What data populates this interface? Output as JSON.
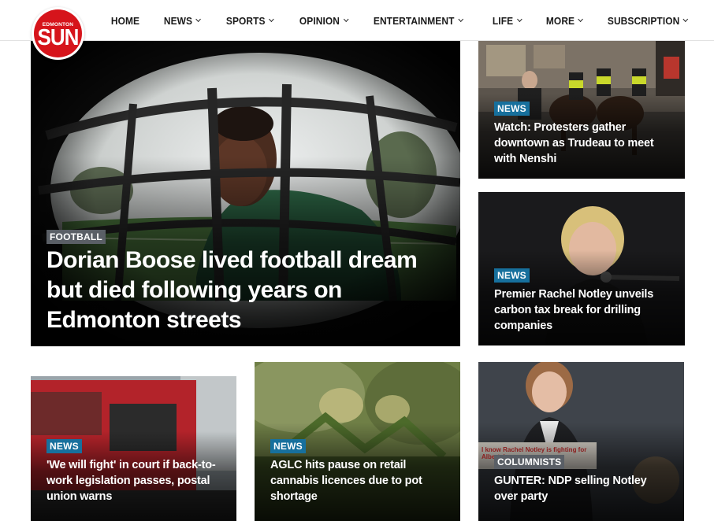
{
  "site": {
    "logo_top": "EDMONTON",
    "logo_main": "SUN"
  },
  "nav": {
    "items": [
      {
        "label": "HOME",
        "dropdown": false
      },
      {
        "label": "NEWS",
        "dropdown": true
      },
      {
        "label": "SPORTS",
        "dropdown": true
      },
      {
        "label": "OPINION",
        "dropdown": true
      },
      {
        "label": "ENTERTAINMENT",
        "dropdown": true
      },
      {
        "label": "LIFE",
        "dropdown": true
      },
      {
        "label": "MORE",
        "dropdown": true
      },
      {
        "label": "SUBSCRIPTION",
        "dropdown": true
      }
    ]
  },
  "colors": {
    "brand_red": "#d6141b",
    "news_badge": "#17709d",
    "section_badge_gray": "#5a5f66"
  },
  "stories": {
    "featured": {
      "category": "FOOTBALL",
      "headline": "Dorian Boose lived football dream but died following years on Edmonton streets"
    },
    "right_top": {
      "category": "NEWS",
      "headline": "Watch: Protesters gather downtown as Trudeau to meet with Nenshi"
    },
    "right_middle": {
      "category": "NEWS",
      "headline": "Premier Rachel Notley unveils carbon tax break for drilling companies"
    },
    "bottom_left": {
      "category": "NEWS",
      "headline": "'We will fight' in court if back-to-work legislation passes, postal union warns"
    },
    "bottom_middle": {
      "category": "NEWS",
      "headline": "AGLC hits pause on retail cannabis licences due to pot shortage"
    },
    "bottom_right": {
      "category": "COLUMNISTS",
      "headline": "GUNTER: NDP selling Notley over party",
      "photo_sign_text": "I know Rachel Notley is fighting for Alberta's energy"
    }
  }
}
